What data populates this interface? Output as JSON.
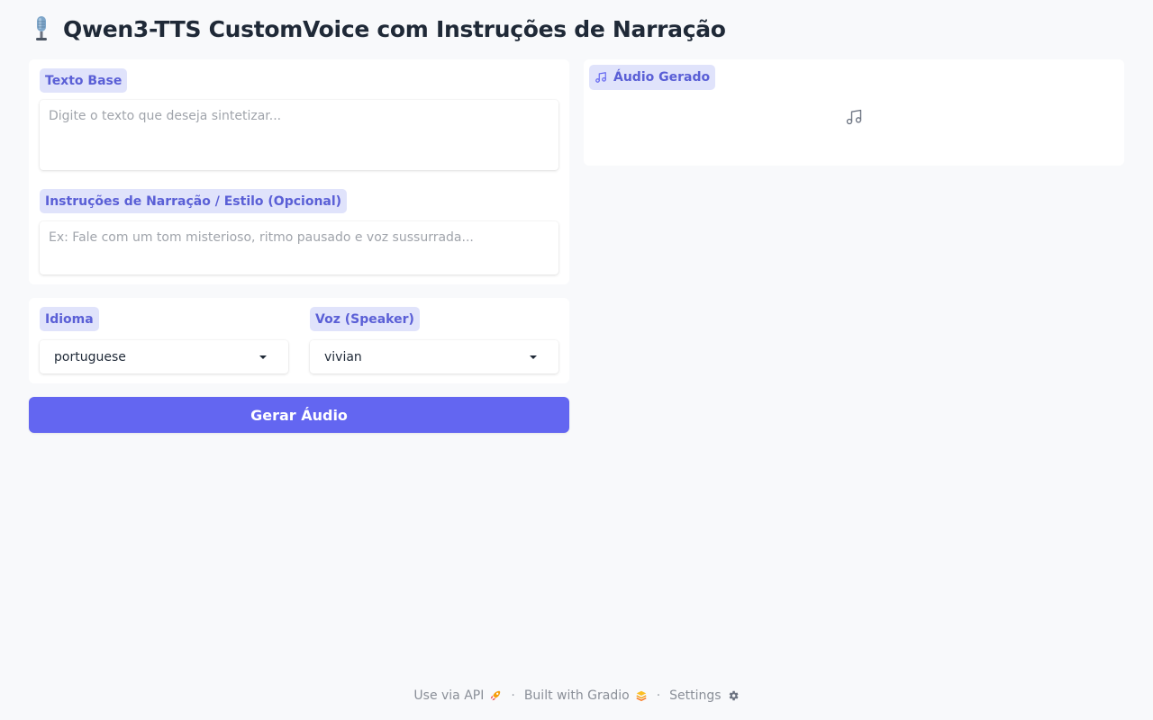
{
  "app": {
    "title": "Qwen3-TTS CustomVoice com Instruções de Narração",
    "title_icon": "microphone-icon"
  },
  "inputs": {
    "text_label": "Texto Base",
    "text_value": "",
    "text_placeholder": "Digite o texto que deseja sintetizar...",
    "instructions_label": "Instruções de Narração / Estilo (Opcional)",
    "instructions_value": "",
    "instructions_placeholder": "Ex: Fale com um tom misterioso, ritmo pausado e voz sussurrada..."
  },
  "options": {
    "language_label": "Idioma",
    "language_value": "portuguese",
    "speaker_label": "Voz (Speaker)",
    "speaker_value": "vivian"
  },
  "actions": {
    "generate_label": "Gerar Áudio"
  },
  "output": {
    "audio_label": "Áudio Gerado",
    "audio_label_icon": "music-note-icon",
    "empty_icon": "music-note-icon"
  },
  "footer": {
    "api_label": "Use via API",
    "api_icon": "rocket-icon",
    "built_label": "Built with Gradio",
    "built_icon": "gradio-logo-icon",
    "settings_label": "Settings",
    "settings_icon": "gear-icon",
    "separator": "·"
  },
  "colors": {
    "accent": "#6366f1",
    "label_bg": "#e0e3fb",
    "label_text": "#5a5fd6",
    "page_bg": "#f8f9fb"
  }
}
